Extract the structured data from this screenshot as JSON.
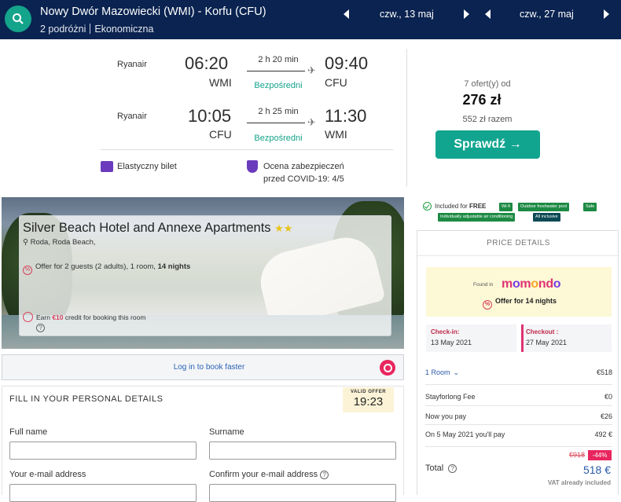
{
  "search": {
    "route": "Nowy Dwór Mazowiecki (WMI) - Korfu (CFU)",
    "travellers": "2 podróżni",
    "cabin": "Ekonomiczna",
    "depart_date": "czw., 13 maj",
    "return_date": "czw., 27 maj"
  },
  "flights": [
    {
      "airline": "Ryanair",
      "dep_time": "06:20",
      "dep_code": "WMI",
      "duration": "2 h 20 min",
      "stops": "Bezpośredni",
      "arr_time": "09:40",
      "arr_code": "CFU"
    },
    {
      "airline": "Ryanair",
      "dep_time": "10:05",
      "dep_code": "CFU",
      "duration": "2 h 25 min",
      "stops": "Bezpośredni",
      "arr_time": "11:30",
      "arr_code": "WMI"
    }
  ],
  "features": {
    "flexible": "Elastyczny bilet",
    "covid_line1": "Ocena zabezpieczeń",
    "covid_line2": "przed COVID-19: 4/5"
  },
  "offer": {
    "count": "7 ofert(y) od",
    "price": "276 zł",
    "total": "552 zł razem",
    "cta": "Sprawdź →"
  },
  "hotel": {
    "name": "Silver Beach Hotel and Annexe Apartments",
    "stars": "★★",
    "location": "Roda, Roda Beach,",
    "offer_prefix": "Offer for 2 guests (2 adults), 1 room, ",
    "offer_nights": "14 nights",
    "earn_prefix": "Earn ",
    "earn_amount": "€10",
    "earn_suffix": " credit for booking this room"
  },
  "login": {
    "text": "Log in to book faster"
  },
  "personal": {
    "title": "FILL IN YOUR PERSONAL DETAILS",
    "valid_label": "VALID OFFER",
    "valid_time": "19:23",
    "full_name": "Full name",
    "surname": "Surname",
    "email": "Your e-mail address",
    "confirm_email": "Confirm your e-mail address"
  },
  "included": {
    "prefix": "Included for ",
    "free": "FREE",
    "tags": [
      "Wi-fi",
      "Outdoor freshwater pool",
      "Safe",
      "Individually adjustable air conditioning",
      "All inclusive"
    ]
  },
  "price_details": {
    "title": "PRICE DETAILS",
    "found_in": "Found in",
    "brand": "momondo",
    "offer": "Offer for 14 nights",
    "checkin_label": "Check-in:",
    "checkin": "13 May 2021",
    "checkout_label": "Checkout :",
    "checkout": "27 May 2021",
    "rooms": [
      {
        "label": "1 Room",
        "value": "€518"
      },
      {
        "label": "Stayforlong Fee",
        "value": "€0"
      },
      {
        "label": "Now you pay",
        "value": "€26"
      },
      {
        "label": "On 5 May 2021 you'll pay",
        "value": "492 €"
      }
    ],
    "old_price": "€918",
    "discount": "-44%",
    "total_label": "Total",
    "total": "518 €",
    "vat": "VAT already included"
  },
  "colors": {
    "header": "#0a2350",
    "accent": "#14a38b",
    "price_blue": "#2a5aa8",
    "discount": "#e8265e"
  }
}
